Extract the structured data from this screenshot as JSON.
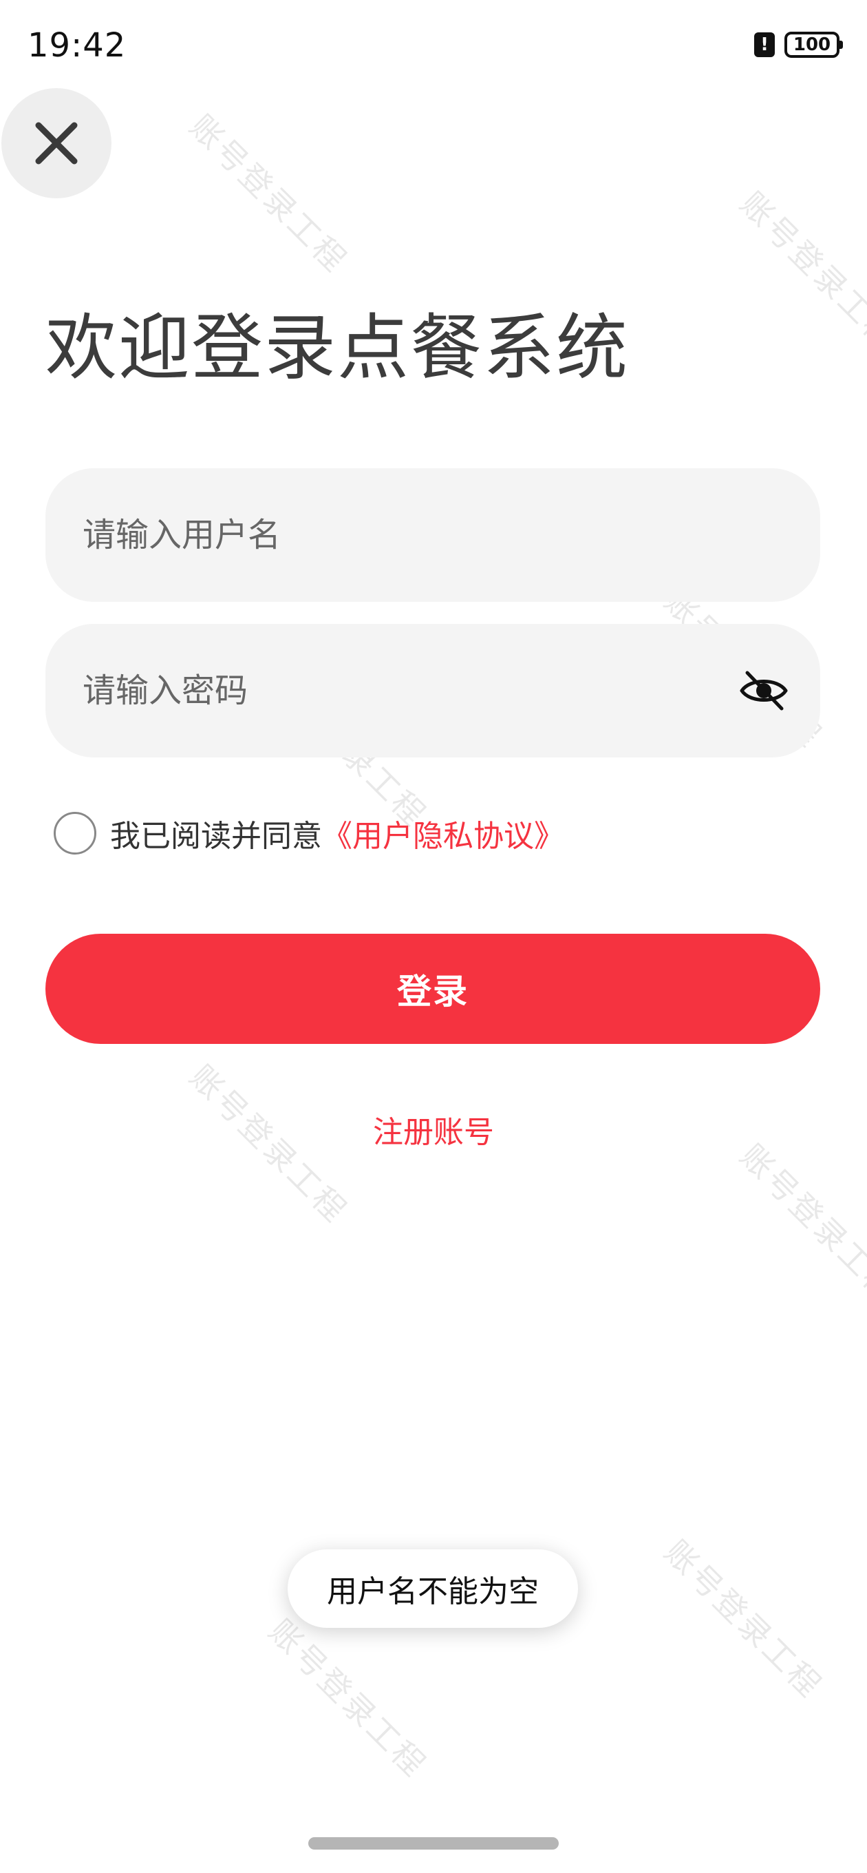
{
  "status_bar": {
    "time": "19:42",
    "battery": "100",
    "alert_symbol": "!"
  },
  "login": {
    "title": "欢迎登录点餐系统",
    "username_placeholder": "请输入用户名",
    "password_placeholder": "请输入密码",
    "agree_text": "我已阅读并同意",
    "agree_link": "《用户隐私协议》",
    "login_button": "登录",
    "register_link": "注册账号"
  },
  "toast": {
    "message": "用户名不能为空"
  },
  "watermark": {
    "text": "账号登录工程"
  },
  "colors": {
    "accent": "#f53340",
    "field_bg": "#f4f4f4",
    "close_bg": "#eeeeee"
  },
  "icons": {
    "close": "close-icon",
    "eye_toggle": "eye-off-icon",
    "alert": "alert-icon",
    "battery": "battery-icon"
  }
}
